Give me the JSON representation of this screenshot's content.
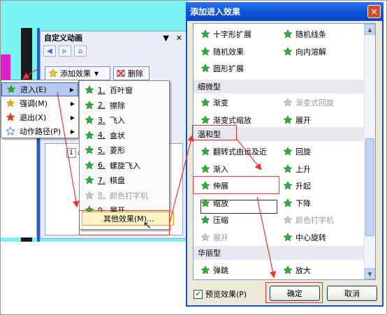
{
  "taskpane": {
    "title": "自定义动画",
    "add_effect": "添加效果",
    "remove": "删除",
    "item_number": "1"
  },
  "menu1": [
    {
      "label": "进入(E)",
      "icon": "green-star-icon",
      "color": "#27a52b"
    },
    {
      "label": "强调(M)",
      "icon": "sun-star-icon",
      "color": "#e4a41e"
    },
    {
      "label": "退出(X)",
      "icon": "red-star-icon",
      "color": "#e03c24"
    },
    {
      "label": "动作路径(P)",
      "icon": "outline-star-icon",
      "color": "#2b4fa8"
    }
  ],
  "menu2": [
    {
      "n": "1.",
      "label": "百叶窗",
      "dim": false
    },
    {
      "n": "2.",
      "label": "擦除",
      "dim": false
    },
    {
      "n": "3.",
      "label": "飞入",
      "dim": false
    },
    {
      "n": "4.",
      "label": "盒状",
      "dim": false
    },
    {
      "n": "5.",
      "label": "菱形",
      "dim": false
    },
    {
      "n": "6.",
      "label": "螺旋飞入",
      "dim": false
    },
    {
      "n": "7.",
      "label": "棋盘",
      "dim": false
    },
    {
      "n": "8.",
      "label": "颜色打字机",
      "dim": true
    },
    {
      "n": "9.",
      "label": "展开",
      "dim": false
    }
  ],
  "more_effects": "其他效果(M)...",
  "dialog": {
    "title": "添加进入效果",
    "close": "✕",
    "top_items": [
      {
        "label": "十字形扩展",
        "col": 0,
        "row": 0
      },
      {
        "label": "随机线条",
        "col": 1,
        "row": 0
      },
      {
        "label": "随机效果",
        "col": 0,
        "row": 1
      },
      {
        "label": "向内溶解",
        "col": 1,
        "row": 1
      },
      {
        "label": "圆形扩展",
        "col": 0,
        "row": 2
      }
    ],
    "cat_subtle": "细微型",
    "subtle_items": [
      {
        "label": "渐变",
        "col": 0,
        "row": 0,
        "dim": false
      },
      {
        "label": "渐变式回旋",
        "col": 1,
        "row": 0,
        "dim": true
      },
      {
        "label": "渐变式缩放",
        "col": 0,
        "row": 1,
        "dim": false
      },
      {
        "label": "展开",
        "col": 1,
        "row": 1,
        "dim": false
      }
    ],
    "cat_moderate": "温和型",
    "moderate_items": [
      {
        "label": "翻转式由远及近",
        "col": 0,
        "row": 0,
        "dim": false
      },
      {
        "label": "回旋",
        "col": 1,
        "row": 0,
        "dim": false
      },
      {
        "label": "渐入",
        "col": 0,
        "row": 1,
        "dim": false
      },
      {
        "label": "上升",
        "col": 1,
        "row": 1,
        "dim": false
      },
      {
        "label": "伸展",
        "col": 0,
        "row": 2,
        "dim": false
      },
      {
        "label": "升起",
        "col": 1,
        "row": 2,
        "dim": false
      },
      {
        "label": "缩放",
        "col": 0,
        "row": 3,
        "dim": false
      },
      {
        "label": "下降",
        "col": 1,
        "row": 3,
        "dim": false
      },
      {
        "label": "压缩",
        "col": 0,
        "row": 4,
        "dim": false
      },
      {
        "label": "颜色打字机",
        "col": 1,
        "row": 4,
        "dim": true
      },
      {
        "label": "展开",
        "col": 0,
        "row": 5,
        "dim": true
      },
      {
        "label": "中心旋转",
        "col": 1,
        "row": 5,
        "dim": false
      }
    ],
    "cat_exciting": "华丽型",
    "exciting_items": [
      {
        "label": "弹跳",
        "col": 0,
        "row": 0,
        "dim": false
      },
      {
        "label": "放大",
        "col": 1,
        "row": 0,
        "dim": false
      }
    ],
    "preview_label": "预览效果(P)",
    "ok": "确定",
    "cancel": "取消"
  },
  "colors": {
    "accent_blue": "#0a54d8",
    "highlight_red": "#e33333",
    "star_green": "#27a52b",
    "background_cyan": "#7cf2f2"
  }
}
